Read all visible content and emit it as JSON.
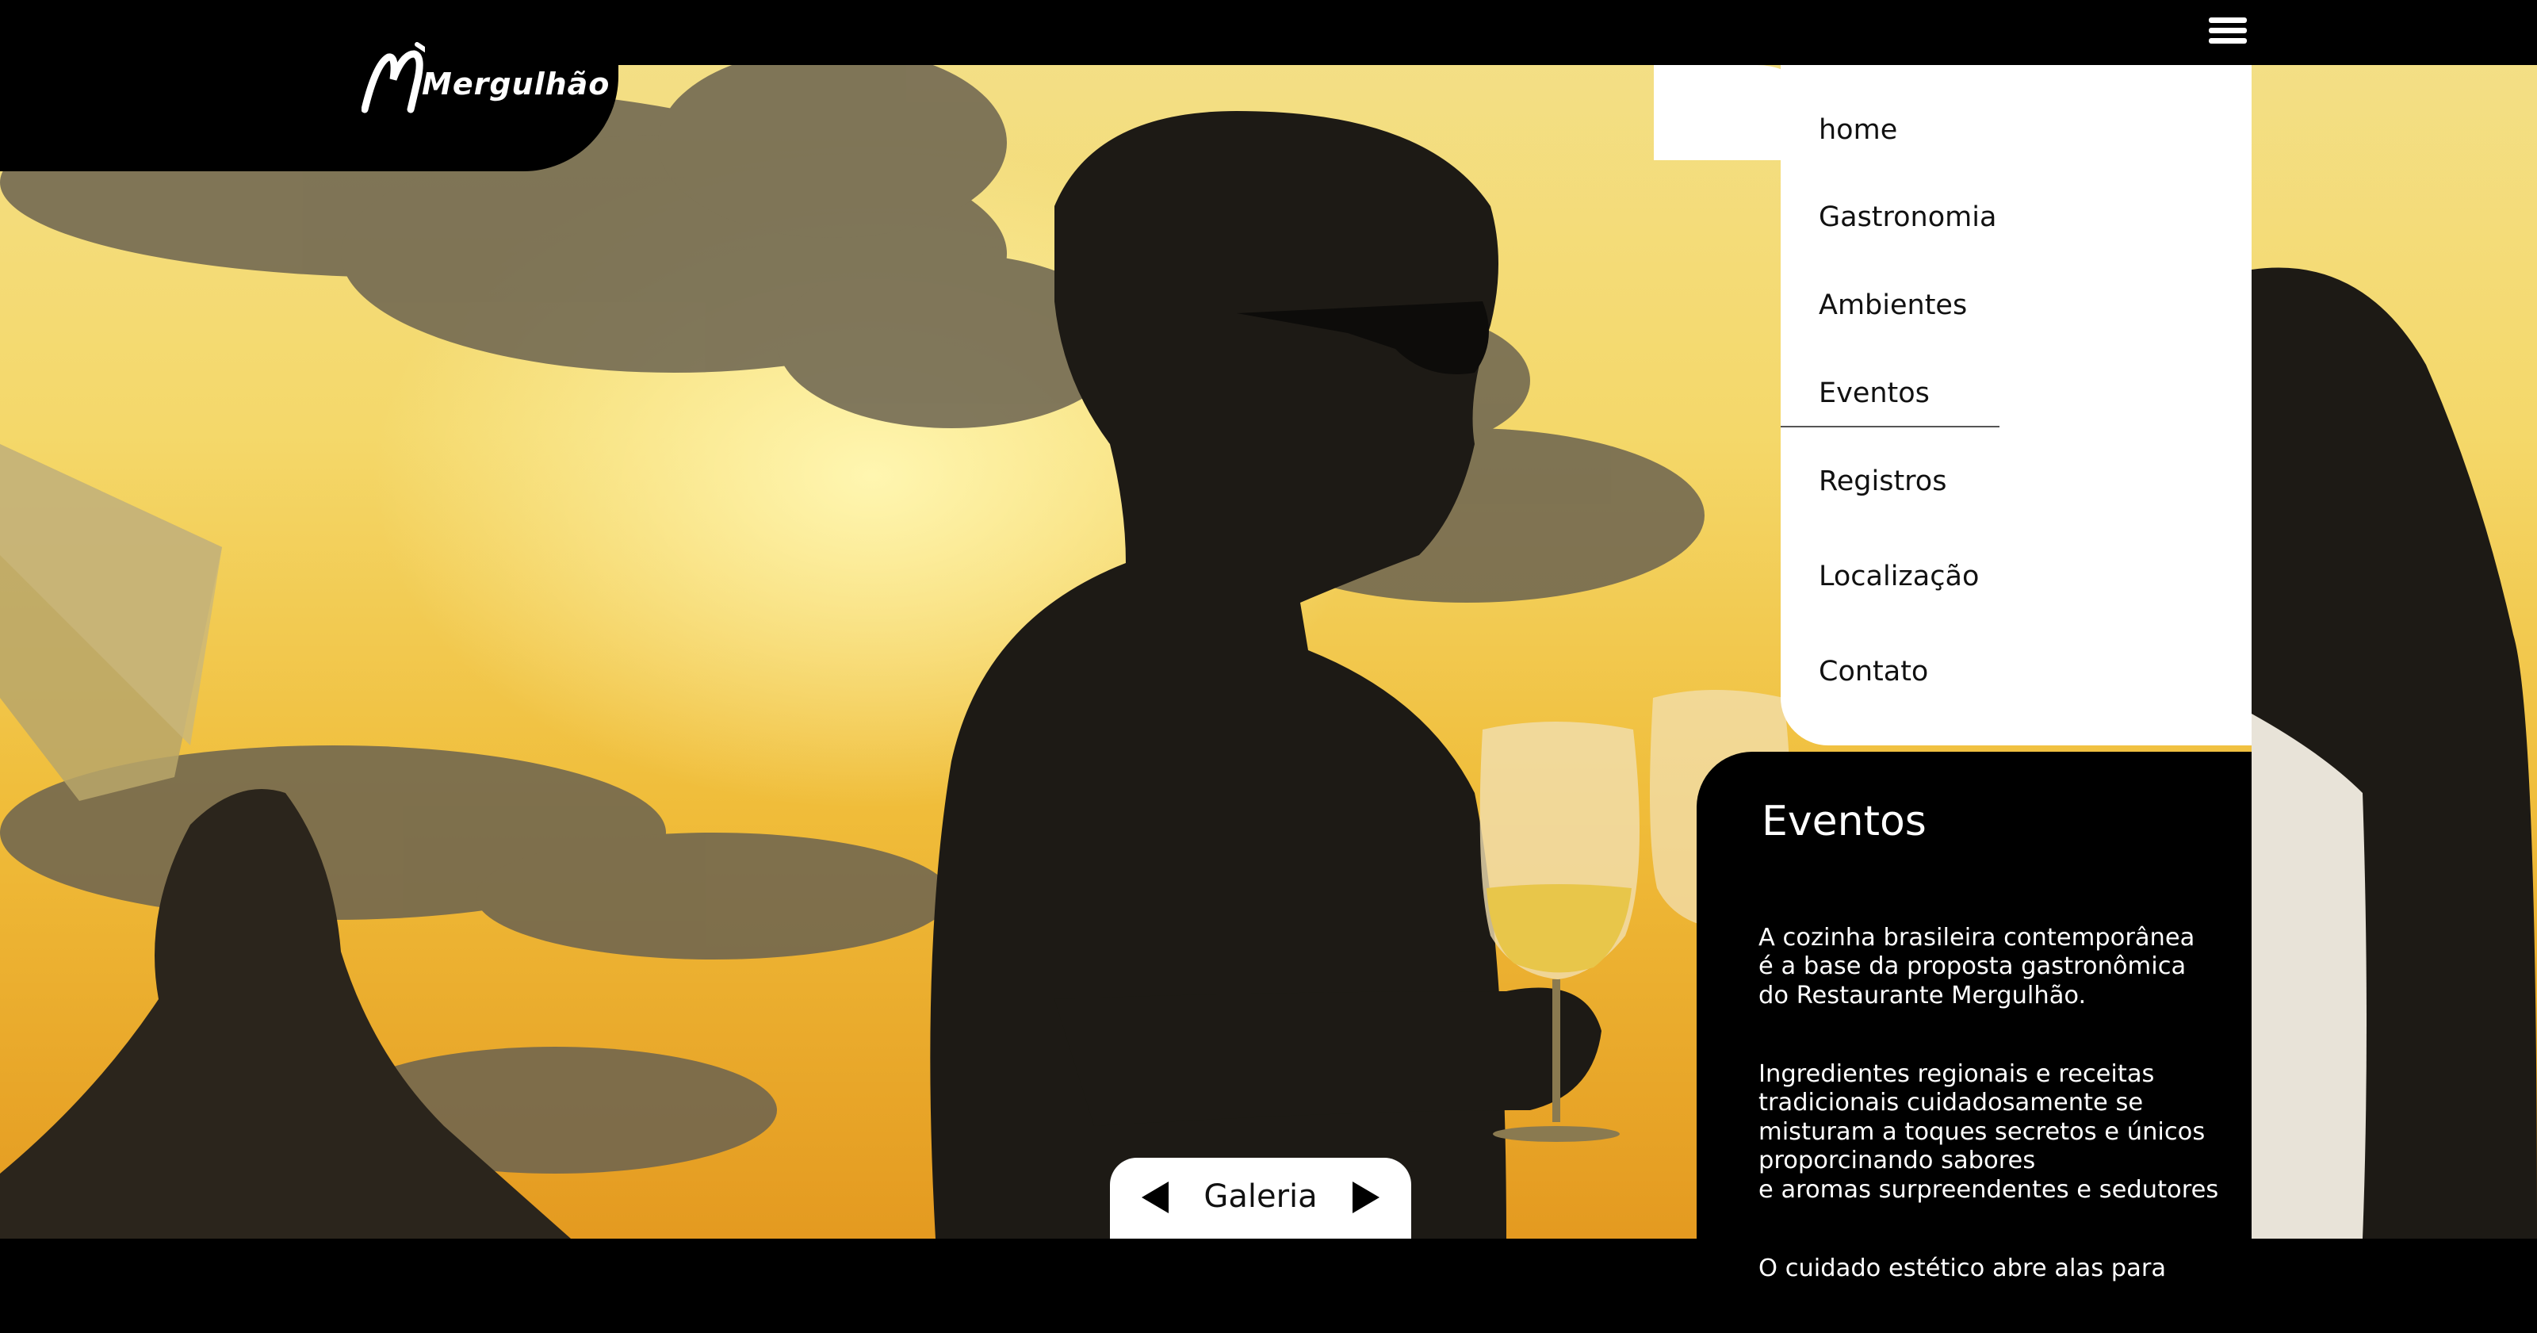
{
  "brand": {
    "name": "Mergulhão"
  },
  "icons": {
    "menu": "hamburger-menu-icon",
    "prev": "chevron-left-icon",
    "next": "chevron-right-icon"
  },
  "nav": {
    "items": [
      {
        "label": "home"
      },
      {
        "label": "Gastronomia"
      },
      {
        "label": "Ambientes"
      },
      {
        "label": "Eventos"
      },
      {
        "label": "Registros"
      },
      {
        "label": "Localização"
      },
      {
        "label": "Contato"
      }
    ],
    "active": "Eventos"
  },
  "info": {
    "title": "Eventos",
    "paragraphs": [
      "A cozinha brasileira contemporânea\né a base da proposta gastronômica\ndo Restaurante Mergulhão.",
      "Ingredientes regionais e receitas\ntradicionais cuidadosamente se\nmisturam a toques secretos e únicos\nproporcinando sabores\ne aromas surpreendentes e sedutores",
      "O cuidado estético abre alas para"
    ]
  },
  "gallery": {
    "label": "Galeria"
  },
  "colors": {
    "header": "#000000",
    "panel": "#ffffff",
    "sky": "#f4d86a"
  }
}
